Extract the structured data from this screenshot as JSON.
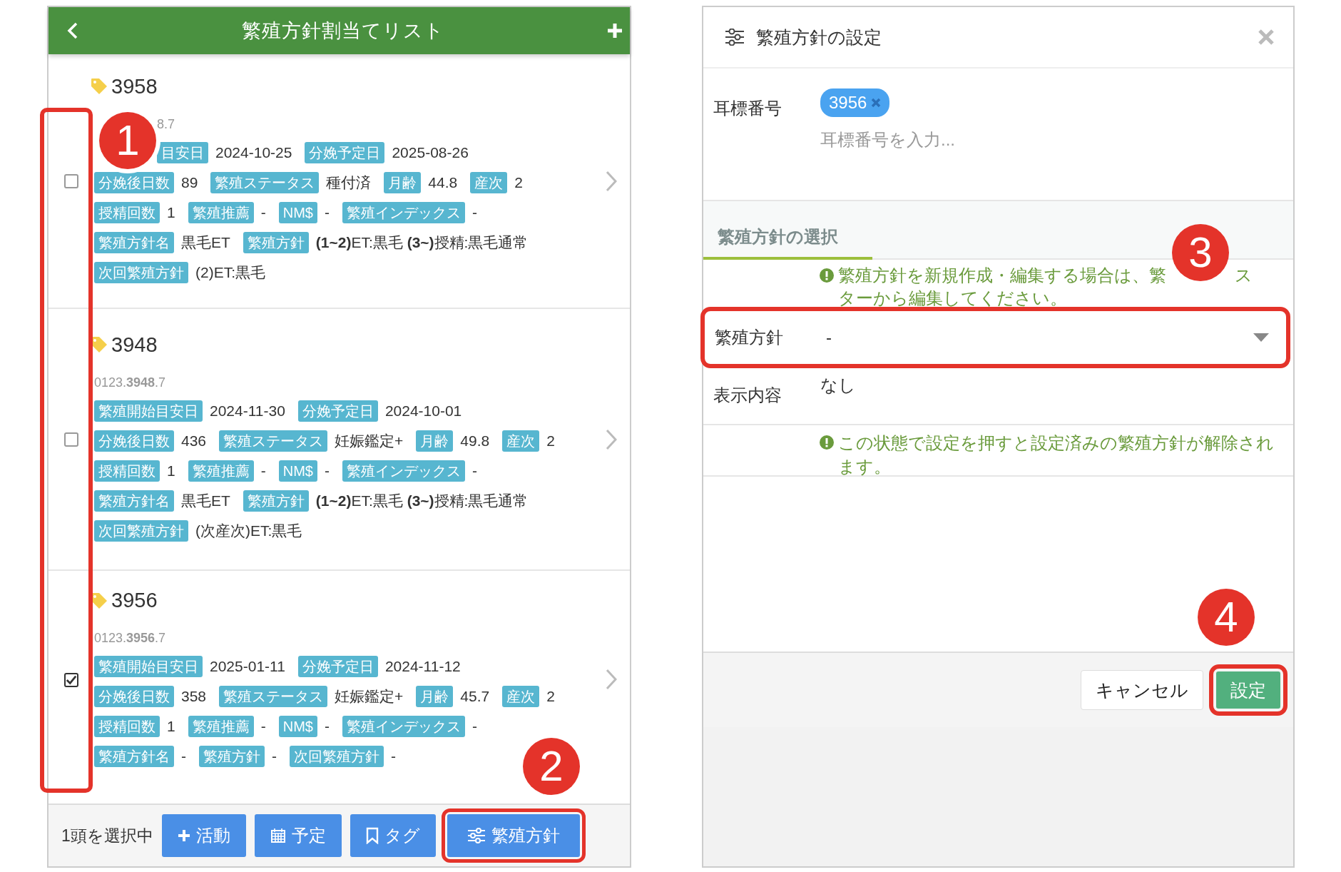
{
  "list_panel": {
    "title": "繁殖方針割当てリスト",
    "rows": [
      {
        "ear_tag": "3958",
        "id_text": "8.7",
        "checked": false,
        "lines": [
          [
            {
              "label": "目安日",
              "value": "2024-10-25"
            },
            {
              "label": "分娩予定日",
              "value": "2025-08-26"
            }
          ],
          [
            {
              "label": "分娩後日数",
              "value": "89"
            },
            {
              "label": "繁殖ステータス",
              "value": "種付済"
            },
            {
              "label": "月齢",
              "value": "44.8"
            },
            {
              "label": "産次",
              "value": "2"
            }
          ],
          [
            {
              "label": "授精回数",
              "value": "1"
            },
            {
              "label": "繁殖推薦",
              "value": "-"
            },
            {
              "label": "NM$",
              "value": "-"
            },
            {
              "label": "繁殖インデックス",
              "value": "-"
            }
          ],
          [
            {
              "label": "繁殖方針名",
              "value": "黒毛ET"
            },
            {
              "label": "繁殖方針",
              "value": "**(1~2)**ET:黒毛  **(3~)**授精:黒毛通常"
            }
          ],
          [
            {
              "label": "次回繁殖方針",
              "value": "(2)ET:黒毛"
            }
          ]
        ]
      },
      {
        "ear_tag": "3948",
        "id_text": "0123.**3948**.7",
        "checked": false,
        "lines": [
          [
            {
              "label": "繁殖開始目安日",
              "value": "2024-11-30"
            },
            {
              "label": "分娩予定日",
              "value": "2024-10-01"
            }
          ],
          [
            {
              "label": "分娩後日数",
              "value": "436"
            },
            {
              "label": "繁殖ステータス",
              "value": "妊娠鑑定+"
            },
            {
              "label": "月齢",
              "value": "49.8"
            },
            {
              "label": "産次",
              "value": "2"
            }
          ],
          [
            {
              "label": "授精回数",
              "value": "1"
            },
            {
              "label": "繁殖推薦",
              "value": "-"
            },
            {
              "label": "NM$",
              "value": "-"
            },
            {
              "label": "繁殖インデックス",
              "value": "-"
            }
          ],
          [
            {
              "label": "繁殖方針名",
              "value": "黒毛ET"
            },
            {
              "label": "繁殖方針",
              "value": "**(1~2)**ET:黒毛  **(3~)**授精:黒毛通常"
            }
          ],
          [
            {
              "label": "次回繁殖方針",
              "value": "(次産次)ET:黒毛"
            }
          ]
        ]
      },
      {
        "ear_tag": "3956",
        "id_text": "0123.**3956**.7",
        "checked": true,
        "lines": [
          [
            {
              "label": "繁殖開始目安日",
              "value": "2025-01-11"
            },
            {
              "label": "分娩予定日",
              "value": "2024-11-12"
            }
          ],
          [
            {
              "label": "分娩後日数",
              "value": "358"
            },
            {
              "label": "繁殖ステータス",
              "value": "妊娠鑑定+"
            },
            {
              "label": "月齢",
              "value": "45.7"
            },
            {
              "label": "産次",
              "value": "2"
            }
          ],
          [
            {
              "label": "授精回数",
              "value": "1"
            },
            {
              "label": "繁殖推薦",
              "value": "-"
            },
            {
              "label": "NM$",
              "value": "-"
            },
            {
              "label": "繁殖インデックス",
              "value": "-"
            }
          ],
          [
            {
              "label": "繁殖方針名",
              "value": "-"
            },
            {
              "label": "繁殖方針",
              "value": "-"
            },
            {
              "label": "次回繁殖方針",
              "value": "-"
            }
          ]
        ]
      }
    ],
    "selection_text": "1頭を選択中",
    "actions": [
      {
        "kind": "plus",
        "label": "活動"
      },
      {
        "kind": "calendar",
        "label": "予定"
      },
      {
        "kind": "bookmark",
        "label": "タグ"
      },
      {
        "kind": "sliders",
        "label": "繁殖方針"
      }
    ]
  },
  "dialog": {
    "title": "繁殖方針の設定",
    "ear_tag_label": "耳標番号",
    "ear_tag_chip": "3956",
    "ear_tag_placeholder": "耳標番号を入力...",
    "section_tab": "繁殖方針の選択",
    "note_parts": [
      "繁殖方針を新規作成・編集する場合は、繁",
      "ス",
      "ターから編集してください。"
    ],
    "policy_label": "繁殖方針",
    "policy_value": "-",
    "display_label": "表示内容",
    "display_value": "なし",
    "warning": "この状態で設定を押すと設定済みの繁殖方針が解除されます。",
    "cancel_button": "キャンセル",
    "confirm_button": "設定"
  },
  "callouts": [
    "1",
    "2",
    "3",
    "4"
  ]
}
